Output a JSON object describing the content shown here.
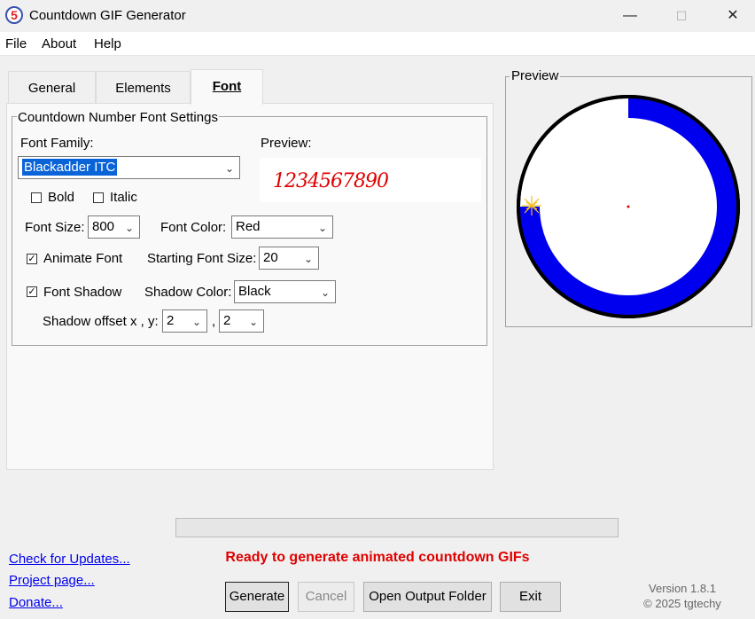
{
  "window": {
    "app_icon_glyph": "5",
    "title": "Countdown GIF Generator",
    "minimize": "—",
    "maximize": "☐",
    "close": "✕"
  },
  "menu": [
    "File",
    "About",
    "Help"
  ],
  "tabs": [
    {
      "label": "General",
      "active": false
    },
    {
      "label": "Elements",
      "active": false
    },
    {
      "label": "Font",
      "active": true
    }
  ],
  "font_settings": {
    "group_title": "Countdown Number Font Settings",
    "font_family_label": "Font Family:",
    "font_family_value": "Blackadder ITC",
    "preview_label": "Preview:",
    "preview_text": "1234567890",
    "bold_label": "Bold",
    "bold_checked": false,
    "italic_label": "Italic",
    "italic_checked": false,
    "font_size_label": "Font Size:",
    "font_size_value": "800",
    "font_color_label": "Font Color:",
    "font_color_value": "Red",
    "animate_label": "Animate Font",
    "animate_checked": true,
    "starting_size_label": "Starting Font Size:",
    "starting_size_value": "20",
    "shadow_label": "Font Shadow",
    "shadow_checked": true,
    "shadow_color_label": "Shadow Color:",
    "shadow_color_value": "Black",
    "shadow_offset_label": "Shadow offset x , y:",
    "shadow_offset_x": "2",
    "shadow_offset_sep": ",",
    "shadow_offset_y": "2"
  },
  "preview_panel": {
    "title": "Preview",
    "ring_color": "#0000ee",
    "outline_color": "#000000",
    "progress_fraction": 0.75
  },
  "status_text": "Ready to generate animated countdown GIFs",
  "links": [
    "Check for Updates...",
    "Project page...",
    "Donate..."
  ],
  "buttons": {
    "generate": "Generate",
    "cancel": "Cancel",
    "open_output": "Open Output Folder",
    "exit": "Exit"
  },
  "version": "Version 1.8.1",
  "copyright": "© 2025 tgtechy",
  "colors": {
    "status": "#e00000",
    "link": "#0000ee",
    "selection": "#0a64d8"
  }
}
